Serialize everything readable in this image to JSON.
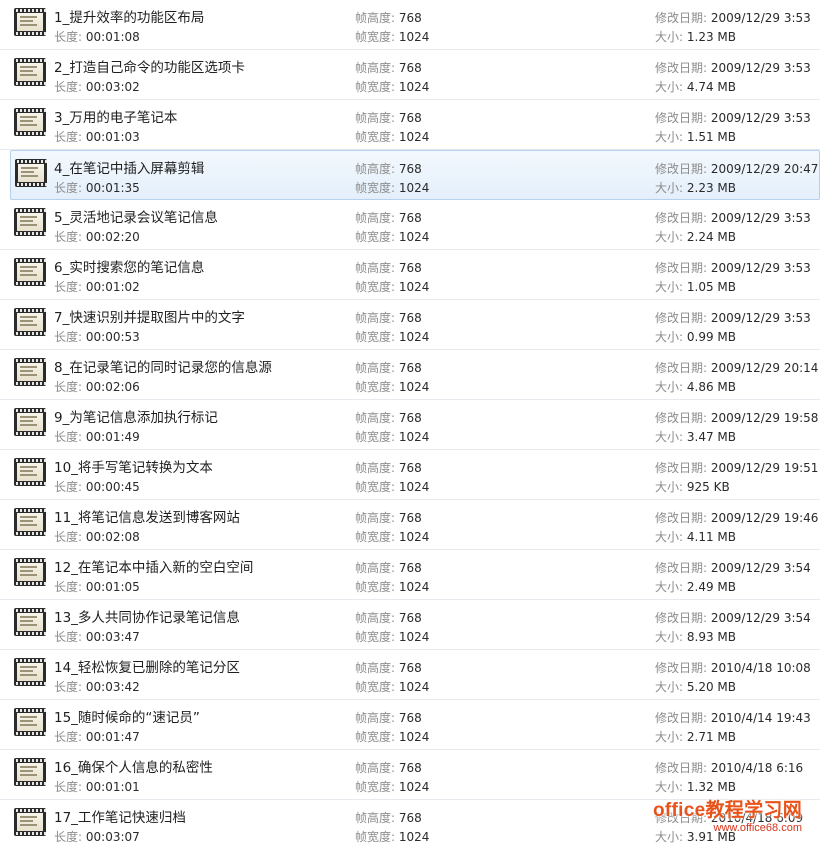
{
  "labels": {
    "length": "长度:",
    "height": "帧高度:",
    "width": "帧宽度:",
    "modified": "修改日期:",
    "size": "大小:"
  },
  "files": [
    {
      "title": "1_提升效率的功能区布局",
      "length": "00:01:08",
      "height": "768",
      "width": "1024",
      "modified": "2009/12/29 3:53",
      "size": "1.23 MB"
    },
    {
      "title": "2_打造自己命令的功能区选项卡",
      "length": "00:03:02",
      "height": "768",
      "width": "1024",
      "modified": "2009/12/29 3:53",
      "size": "4.74 MB"
    },
    {
      "title": "3_万用的电子笔记本",
      "length": "00:01:03",
      "height": "768",
      "width": "1024",
      "modified": "2009/12/29 3:53",
      "size": "1.51 MB"
    },
    {
      "title": "4_在笔记中插入屏幕剪辑",
      "length": "00:01:35",
      "height": "768",
      "width": "1024",
      "modified": "2009/12/29 20:47",
      "size": "2.23 MB",
      "selected": true
    },
    {
      "title": "5_灵活地记录会议笔记信息",
      "length": "00:02:20",
      "height": "768",
      "width": "1024",
      "modified": "2009/12/29 3:53",
      "size": "2.24 MB"
    },
    {
      "title": "6_实时搜索您的笔记信息",
      "length": "00:01:02",
      "height": "768",
      "width": "1024",
      "modified": "2009/12/29 3:53",
      "size": "1.05 MB"
    },
    {
      "title": "7_快速识别并提取图片中的文字",
      "length": "00:00:53",
      "height": "768",
      "width": "1024",
      "modified": "2009/12/29 3:53",
      "size": "0.99 MB"
    },
    {
      "title": "8_在记录笔记的同时记录您的信息源",
      "length": "00:02:06",
      "height": "768",
      "width": "1024",
      "modified": "2009/12/29 20:14",
      "size": "4.86 MB"
    },
    {
      "title": "9_为笔记信息添加执行标记",
      "length": "00:01:49",
      "height": "768",
      "width": "1024",
      "modified": "2009/12/29 19:58",
      "size": "3.47 MB"
    },
    {
      "title": "10_将手写笔记转换为文本",
      "length": "00:00:45",
      "height": "768",
      "width": "1024",
      "modified": "2009/12/29 19:51",
      "size": "925 KB"
    },
    {
      "title": "11_将笔记信息发送到博客网站",
      "length": "00:02:08",
      "height": "768",
      "width": "1024",
      "modified": "2009/12/29 19:46",
      "size": "4.11 MB"
    },
    {
      "title": "12_在笔记本中插入新的空白空间",
      "length": "00:01:05",
      "height": "768",
      "width": "1024",
      "modified": "2009/12/29 3:54",
      "size": "2.49 MB"
    },
    {
      "title": "13_多人共同协作记录笔记信息",
      "length": "00:03:47",
      "height": "768",
      "width": "1024",
      "modified": "2009/12/29 3:54",
      "size": "8.93 MB"
    },
    {
      "title": "14_轻松恢复已删除的笔记分区",
      "length": "00:03:42",
      "height": "768",
      "width": "1024",
      "modified": "2010/4/18 10:08",
      "size": "5.20 MB"
    },
    {
      "title": "15_随时候命的“速记员”",
      "length": "00:01:47",
      "height": "768",
      "width": "1024",
      "modified": "2010/4/14 19:43",
      "size": "2.71 MB"
    },
    {
      "title": "16_确保个人信息的私密性",
      "length": "00:01:01",
      "height": "768",
      "width": "1024",
      "modified": "2010/4/18 6:16",
      "size": "1.32 MB"
    },
    {
      "title": "17_工作笔记快速归档",
      "length": "00:03:07",
      "height": "768",
      "width": "1024",
      "modified": "2010/4/18 6:09",
      "size": "3.91 MB"
    }
  ],
  "watermark": {
    "main": "office教程学习网",
    "url": "www.office68.com"
  },
  "colors": {
    "selection_bg": "#e4effb",
    "selection_border": "#b6d1ee",
    "label_gray": "#8c8c8c",
    "watermark": "#e8531b"
  },
  "icons": {
    "file_thumb": "video-thumbnail-icon"
  }
}
